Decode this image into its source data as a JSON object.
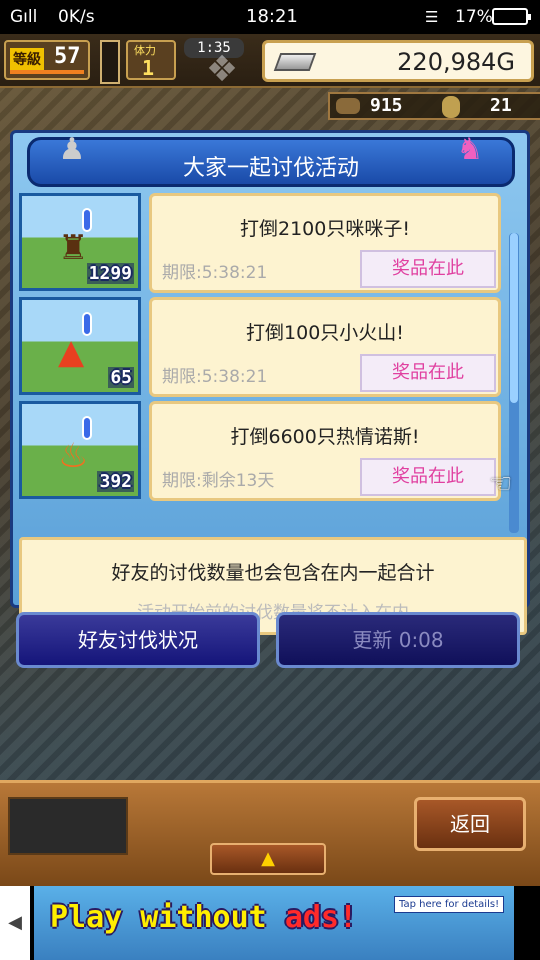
{
  "status_bar": {
    "signal": "Gıll",
    "speed": "0K/s",
    "clock": "18:21",
    "battery": "17%"
  },
  "top_bar": {
    "level_label": "等級",
    "level_value": "57",
    "stamina_label": "体力",
    "stamina_value": "1",
    "timer": "1:35",
    "gold": "220,984G"
  },
  "sub_bar": {
    "grass_value": "915",
    "medal_value": "21"
  },
  "panel": {
    "title": "大家一起讨伐活动",
    "missions": [
      {
        "title": "打倒2100只咪咪子!",
        "deadline": "期限:5:38:21",
        "reward": "奖品在此",
        "count": "1299",
        "monster_icon": "beast-icon"
      },
      {
        "title": "打倒100只小火山!",
        "deadline": "期限:5:38:21",
        "reward": "奖品在此",
        "count": "65",
        "monster_icon": "fire-icon"
      },
      {
        "title": "打倒6600只热情诺斯!",
        "deadline": "期限:剩余13天",
        "reward": "奖品在此",
        "count": "392",
        "monster_icon": "flame-spirit-icon"
      }
    ],
    "info_line1": "好友的讨伐数量也会包含在内一起合计",
    "info_line2": "活动开始前的讨伐数量将不计入在内"
  },
  "buttons": {
    "friend_status": "好友讨伐状况",
    "refresh": "更新 0:08",
    "back": "返回"
  },
  "ad": {
    "text_main": "Play without ",
    "text_ads": "ads!",
    "tap_text": "Tap here for details!"
  }
}
